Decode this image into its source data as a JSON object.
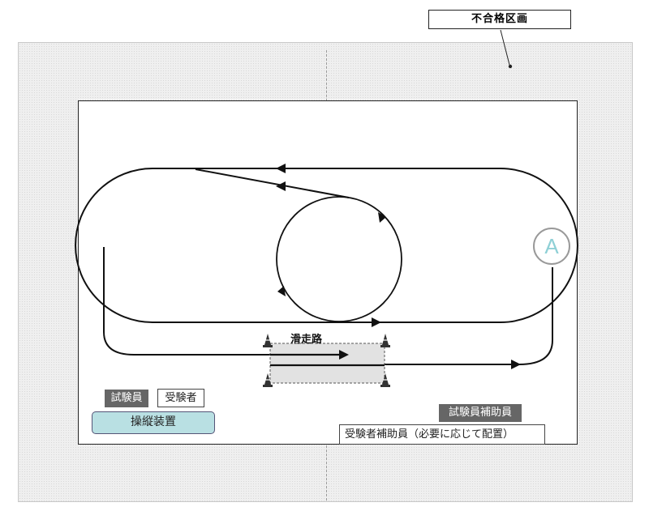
{
  "labels": {
    "fail_zone": "不合格区画",
    "slide_road": "滑走路",
    "examiner": "試験員",
    "examinee": "受験者",
    "control_device": "操縦装置",
    "examiner_assistant": "試験員補助員",
    "examinee_assistant": "受験者補助員（必要に応じて配置）",
    "point_a": "A"
  },
  "colors": {
    "outer_zone": "#efefef",
    "control_box": "#b9e0e3",
    "gray_tag": "#666666",
    "point_a_text": "#8fd0d6"
  },
  "icons": {
    "cones": "traffic-cone-icon"
  }
}
